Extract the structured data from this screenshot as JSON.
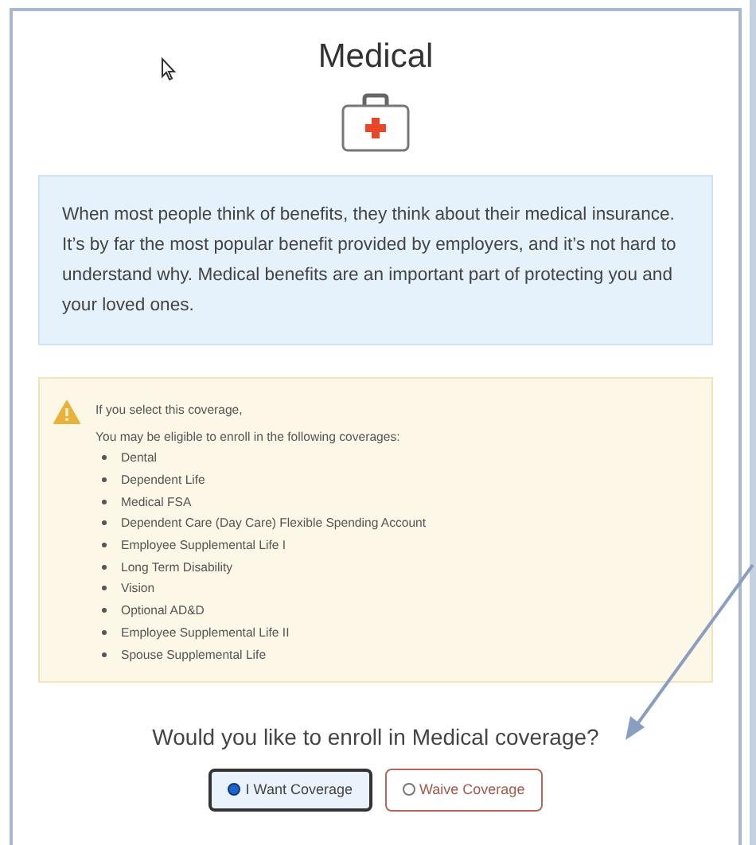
{
  "title": "Medical",
  "description": "When most people think of benefits, they think about their medical insurance. It’s by far the most popular benefit provided by employers, and it’s not hard to understand why. Medical benefits are an important part of protecting you and your loved ones.",
  "notice": {
    "heading": "If you select this coverage,",
    "intro": "You may be eligible to enroll in the following coverages:",
    "items": [
      "Dental",
      "Dependent Life",
      "Medical FSA",
      "Dependent Care (Day Care) Flexible Spending Account",
      "Employee Supplemental Life I",
      "Long Term Disability",
      "Vision",
      "Optional AD&D",
      "Employee Supplemental Life II",
      "Spouse Supplemental Life"
    ]
  },
  "question": "Would you like to enroll in Medical coverage?",
  "options": [
    {
      "label": "I Want Coverage",
      "selected": true
    },
    {
      "label": "Waive Coverage",
      "selected": false
    }
  ]
}
